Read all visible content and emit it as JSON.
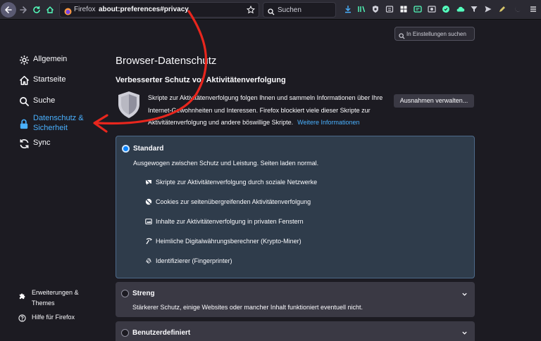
{
  "colors": {
    "accent": "#4ab1ff",
    "annotation_arrow": "#e8261d",
    "card_selected_bg": "#2f3c4b",
    "card_bg": "#3a3944"
  },
  "toolbar": {
    "back_icon": "arrow-left-icon",
    "forward_icon": "arrow-right-icon",
    "reload_icon": "reload-icon",
    "home_icon": "home-icon",
    "urlbar": {
      "brand": "Firefox",
      "url": "about:preferences#privacy"
    },
    "search": {
      "placeholder": "Suchen"
    }
  },
  "sidebar": {
    "items": [
      {
        "label": "Allgemein",
        "icon": "gear-icon"
      },
      {
        "label": "Startseite",
        "icon": "home-icon"
      },
      {
        "label": "Suche",
        "icon": "search-icon"
      },
      {
        "label": "Datenschutz &\nSicherheit",
        "icon": "lock-icon",
        "active": true
      },
      {
        "label": "Sync",
        "icon": "sync-icon"
      }
    ],
    "footer": [
      {
        "label": "Erweiterungen &\nThemes",
        "icon": "puzzle-icon"
      },
      {
        "label": "Hilfe für Firefox",
        "icon": "help-icon"
      }
    ]
  },
  "main": {
    "search_placeholder": "In Einstellungen suchen",
    "title": "Browser-Datenschutz",
    "etp": {
      "heading": "Verbesserter Schutz vor Aktivitätenverfolgung",
      "description": "Skripte zur Aktivitätenverfolgung folgen Ihnen und sammeln Informationen über Ihre Internet-Gewohnheiten und Interessen. Firefox blockiert viele dieser Skripte zur Aktivitätenverfolgung und andere böswillige Skripte.",
      "learn_more": "Weitere Informationen",
      "exceptions_button": "Ausnahmen verwalten..."
    },
    "options": {
      "standard": {
        "label": "Standard",
        "selected": true,
        "description": "Ausgewogen zwischen Schutz und Leistung. Seiten laden normal.",
        "features": [
          {
            "label": "Skripte zur Aktivitätenverfolgung durch soziale Netzwerke",
            "icon": "social-tracker-icon"
          },
          {
            "label": "Cookies zur seitenübergreifenden Aktivitätenverfolgung",
            "icon": "cookie-icon"
          },
          {
            "label": "Inhalte zur Aktivitätenverfolgung in privaten Fenstern",
            "icon": "tracking-content-icon"
          },
          {
            "label": "Heimliche Digitalwährungsberechner (Krypto-Miner)",
            "icon": "cryptominer-icon"
          },
          {
            "label": "Identifizierer (Fingerprinter)",
            "icon": "fingerprint-icon"
          }
        ]
      },
      "strict": {
        "label": "Streng",
        "selected": false,
        "description": "Stärkerer Schutz, einige Websites oder mancher Inhalt funktioniert eventuell nicht."
      },
      "custom": {
        "label": "Benutzerdefiniert",
        "selected": false
      }
    }
  }
}
